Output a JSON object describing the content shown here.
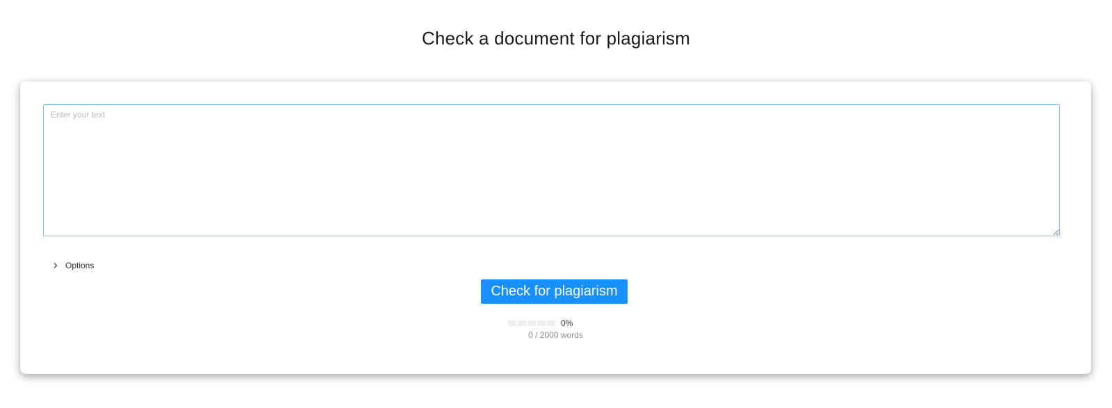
{
  "page": {
    "title": "Check a document for plagiarism"
  },
  "editor": {
    "placeholder": "Enter your text",
    "value": ""
  },
  "options": {
    "label": "Options",
    "expanded": false,
    "icon": "chevron-right-icon"
  },
  "actions": {
    "check_label": "Check for plagiarism"
  },
  "progress": {
    "percent_text": "0%",
    "fraction": 0,
    "steps": 5
  },
  "word_count": {
    "text": "0 / 2000 words"
  },
  "colors": {
    "accent": "#1890ff",
    "input_border": "#7fbff5",
    "progress_empty": "#efefef"
  }
}
